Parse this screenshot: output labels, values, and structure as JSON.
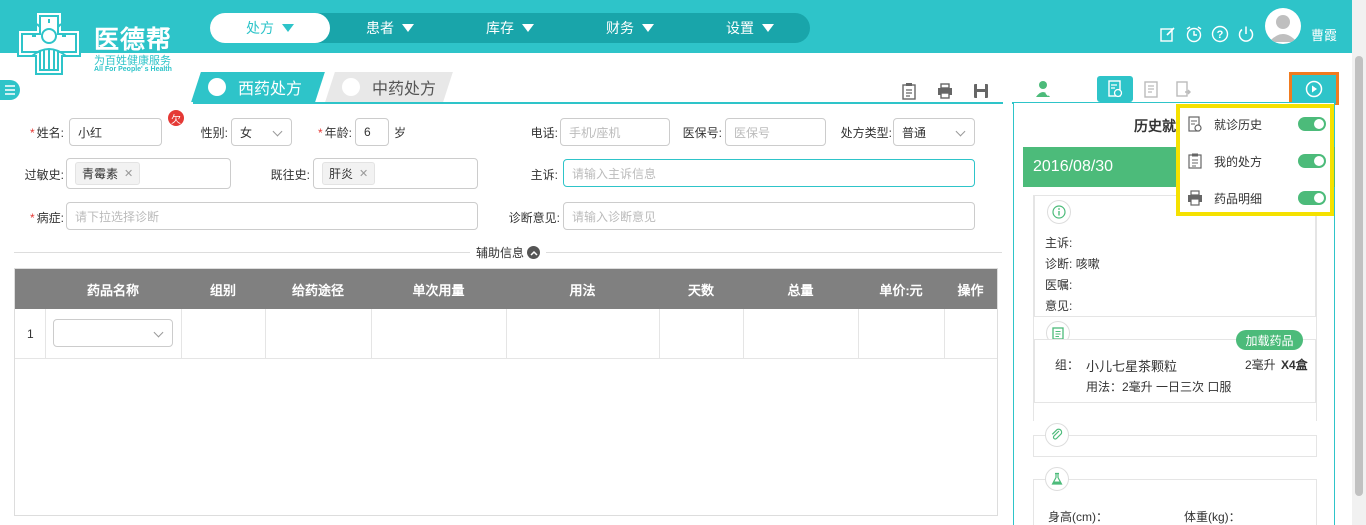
{
  "app": {
    "logo_title": "医德帮",
    "logo_sub": "为百姓健康服务",
    "logo_sub_en": "All For People' s Health",
    "username": "曹霞"
  },
  "nav": [
    {
      "label": "处方",
      "active": true
    },
    {
      "label": "患者",
      "active": false
    },
    {
      "label": "库存",
      "active": false
    },
    {
      "label": "财务",
      "active": false
    },
    {
      "label": "设置",
      "active": false
    }
  ],
  "tabs": {
    "west": "西药处方",
    "chinese": "中药处方"
  },
  "form": {
    "name_label": "姓名:",
    "name_value": "小红",
    "lack_badge": "欠",
    "gender_label": "性别:",
    "gender_value": "女",
    "age_label": "年龄:",
    "age_value": "6",
    "age_unit": "岁",
    "phone_label": "电话:",
    "phone_placeholder": "手机/座机",
    "insurance_label": "医保号:",
    "insurance_placeholder": "医保号",
    "rx_type_label": "处方类型:",
    "rx_type_value": "普通",
    "allergy_label": "过敏史:",
    "allergy_tag": "青霉素",
    "history_label": "既往史:",
    "history_tag": "肝炎",
    "complaint_label": "主诉:",
    "complaint_placeholder": "请输入主诉信息",
    "disease_label": "病症:",
    "disease_placeholder": "请下拉选择诊断",
    "opinion_label": "诊断意见:",
    "opinion_placeholder": "请输入诊断意见",
    "aux_label": "辅助信息"
  },
  "table": {
    "headers": [
      "药品名称",
      "组别",
      "给药途径",
      "单次用量",
      "用法",
      "天数",
      "总量",
      "单价:元",
      "操作"
    ],
    "rows": [
      {
        "index": "1"
      }
    ]
  },
  "right_panel": {
    "title_partial": "历史就",
    "date": "2016/08/30",
    "info": {
      "complaint": "主诉:",
      "diagnosis": "诊断:",
      "diagnosis_value": "咳嗽",
      "advice": "医嘱:",
      "opinion": "意见:"
    },
    "load_drug_button": "加载药品",
    "drug": {
      "group": "组：",
      "name": "小儿七星茶颗粒",
      "dose": "2毫升",
      "qty": "X4盒",
      "usage": "用法：2毫升 一日三次 口服"
    },
    "height_label": "身高(cm)：",
    "weight_label": "体重(kg)："
  },
  "popup": {
    "items": [
      {
        "label": "就诊历史",
        "on": true
      },
      {
        "label": "我的处方",
        "on": true
      },
      {
        "label": "药品明细",
        "on": true
      }
    ]
  },
  "colors": {
    "primary": "#2ec4c9",
    "nav_bg": "#19a5aa",
    "green": "#4cbb7a",
    "highlight_orange": "#f07b1f",
    "highlight_yellow": "#f5e100"
  }
}
